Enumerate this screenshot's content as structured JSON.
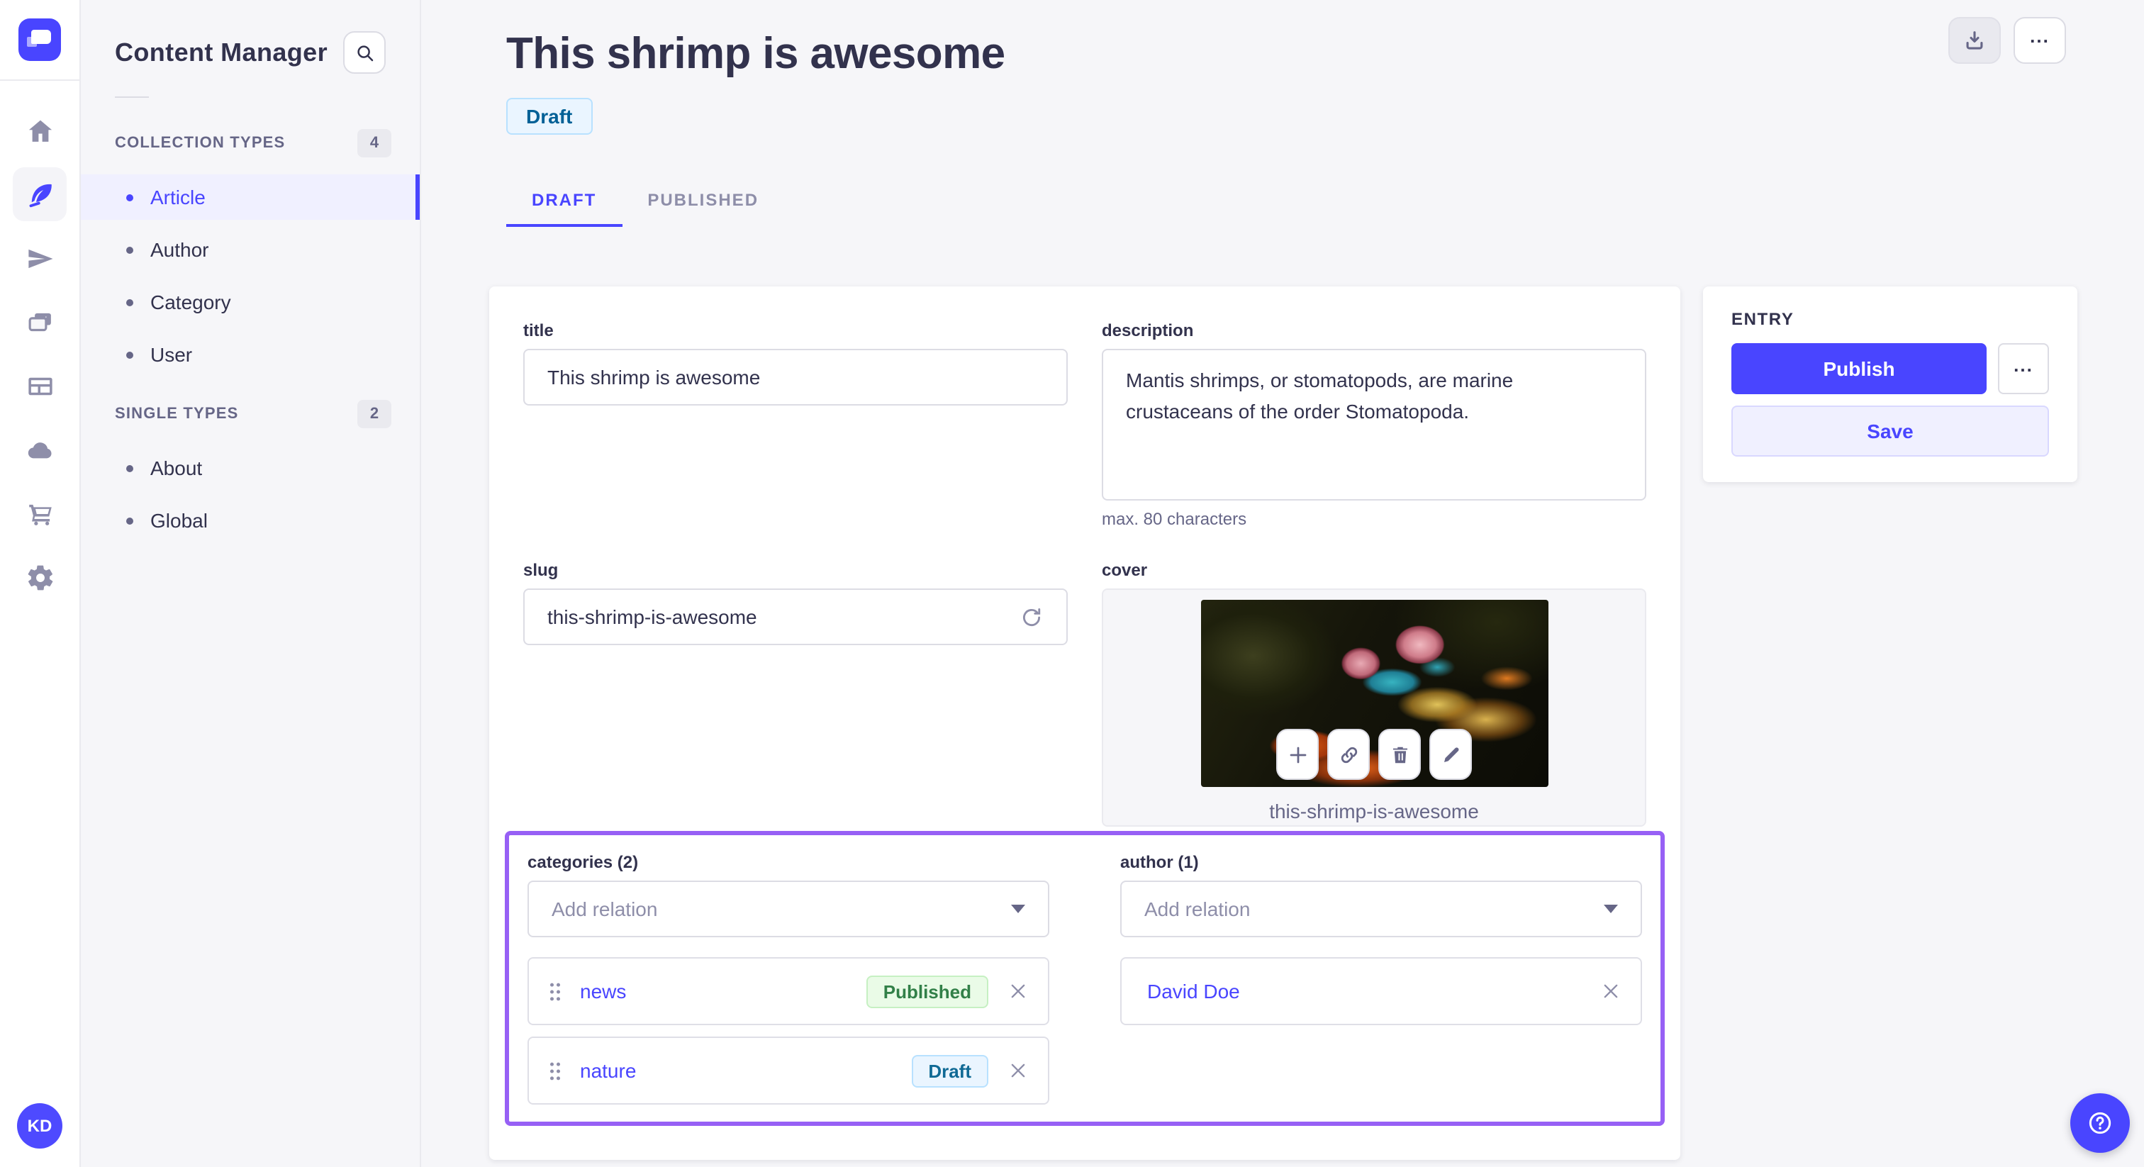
{
  "colors": {
    "accent": "#4945ff",
    "accent_light_bg": "#f0f0ff",
    "page_bg": "#f6f6f9",
    "border": "#dcdce4",
    "text_dark": "#32324d",
    "text_muted": "#666687",
    "relation_highlight": "#9760f5",
    "published_badge": {
      "bg": "#eafbe7",
      "border": "#c6f0c2",
      "text": "#328048"
    },
    "draft_badge": {
      "bg": "#eaf5ff",
      "border": "#b8e1ff",
      "text": "#006096"
    }
  },
  "iconbar": {
    "avatar_initials": "KD",
    "items": [
      {
        "name": "home"
      },
      {
        "name": "content-manager",
        "active": true
      },
      {
        "name": "releases"
      },
      {
        "name": "media-library"
      },
      {
        "name": "content-type-builder"
      },
      {
        "name": "deploy-cloud"
      },
      {
        "name": "marketplace"
      },
      {
        "name": "settings"
      }
    ]
  },
  "subnav": {
    "title": "Content Manager",
    "sections": [
      {
        "label": "COLLECTION TYPES",
        "count": "4",
        "items": [
          {
            "label": "Article",
            "active": true
          },
          {
            "label": "Author"
          },
          {
            "label": "Category"
          },
          {
            "label": "User"
          }
        ]
      },
      {
        "label": "SINGLE TYPES",
        "count": "2",
        "items": [
          {
            "label": "About"
          },
          {
            "label": "Global"
          }
        ]
      }
    ]
  },
  "header": {
    "title": "This shrimp is awesome",
    "status": "Draft",
    "tabs": [
      {
        "label": "DRAFT",
        "active": true
      },
      {
        "label": "PUBLISHED",
        "active": false
      }
    ]
  },
  "form": {
    "title": {
      "label": "title",
      "value": "This shrimp is awesome"
    },
    "description": {
      "label": "description",
      "value": "Mantis shrimps, or stomatopods, are marine crustaceans of the order Stomatopoda.",
      "hint": "max. 80 characters"
    },
    "slug": {
      "label": "slug",
      "value": "this-shrimp-is-awesome"
    },
    "cover": {
      "label": "cover",
      "filename": "this-shrimp-is-awesome"
    },
    "categories": {
      "label": "categories (2)",
      "placeholder": "Add relation",
      "relations": [
        {
          "name": "news",
          "status": "Published"
        },
        {
          "name": "nature",
          "status": "Draft"
        }
      ]
    },
    "author": {
      "label": "author (1)",
      "placeholder": "Add relation",
      "relations": [
        {
          "name": "David Doe"
        }
      ]
    }
  },
  "entry_panel": {
    "title": "ENTRY",
    "publish_label": "Publish",
    "save_label": "Save"
  }
}
